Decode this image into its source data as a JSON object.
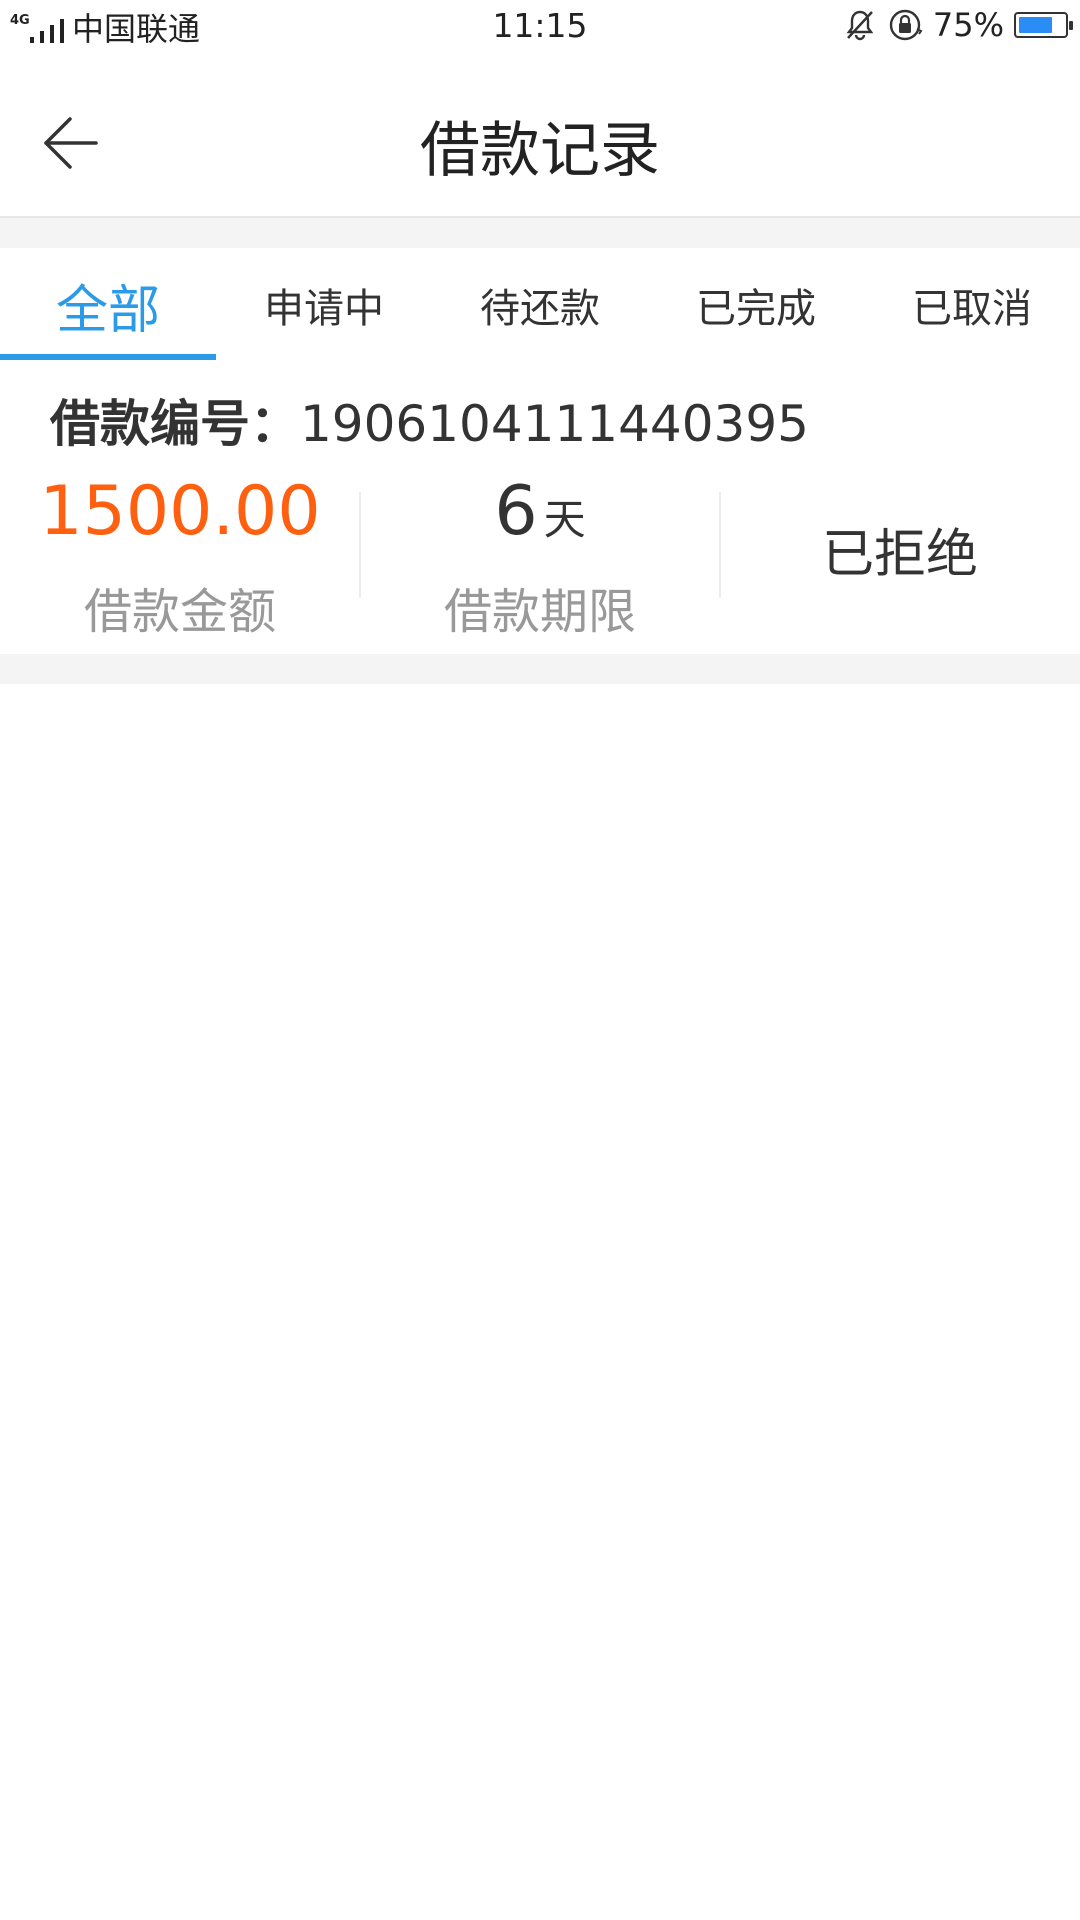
{
  "status_bar": {
    "network": "4G",
    "carrier": "中国联通",
    "time": "11:15",
    "battery_percent": "75%",
    "battery_level": 0.75
  },
  "header": {
    "title": "借款记录",
    "back_icon": "arrow-left-icon"
  },
  "tabs": [
    {
      "label": "全部",
      "active": true
    },
    {
      "label": "申请中",
      "active": false
    },
    {
      "label": "待还款",
      "active": false
    },
    {
      "label": "已完成",
      "active": false
    },
    {
      "label": "已取消",
      "active": false
    }
  ],
  "records": [
    {
      "id_label": "借款编号：",
      "id_value": "1906104111440395",
      "amount": "1500.00",
      "amount_label": "借款金额",
      "term_value": "6",
      "term_unit": "天",
      "term_label": "借款期限",
      "status": "已拒绝"
    }
  ],
  "colors": {
    "accent": "#2b9be8",
    "amount": "#ff6010",
    "muted": "#999999"
  }
}
